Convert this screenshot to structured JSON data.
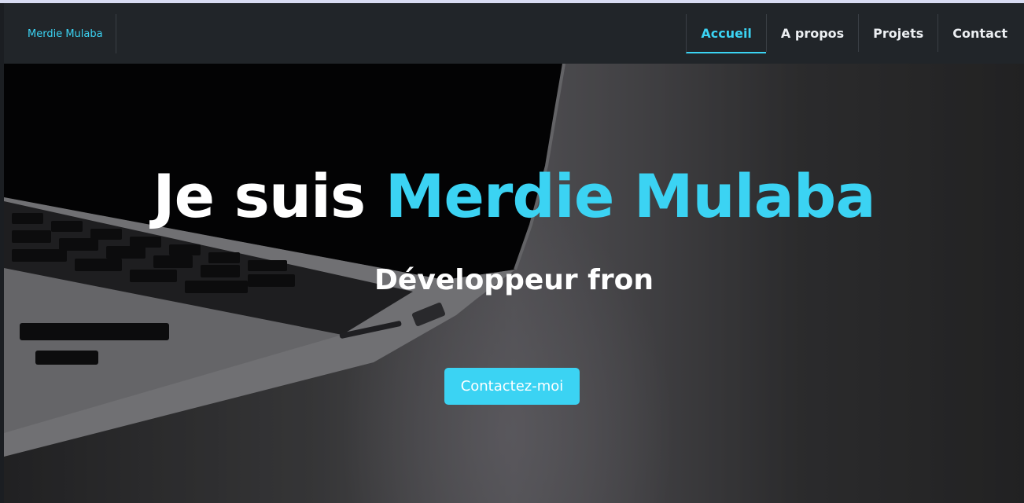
{
  "nav": {
    "brand": "Merdie Mulaba",
    "links": [
      {
        "label": "Accueil",
        "active": true
      },
      {
        "label": "A propos",
        "active": false
      },
      {
        "label": "Projets",
        "active": false
      },
      {
        "label": "Contact",
        "active": false
      }
    ]
  },
  "hero": {
    "title_prefix": "Je suis ",
    "title_name": "Merdie Mulaba",
    "subtitle": "Développeur fron",
    "cta_label": "Contactez-moi",
    "background_image": "laptop-keyboard-photo"
  },
  "colors": {
    "accent": "#3bd3f3",
    "navbar": "#212529",
    "text": "#ffffff"
  }
}
